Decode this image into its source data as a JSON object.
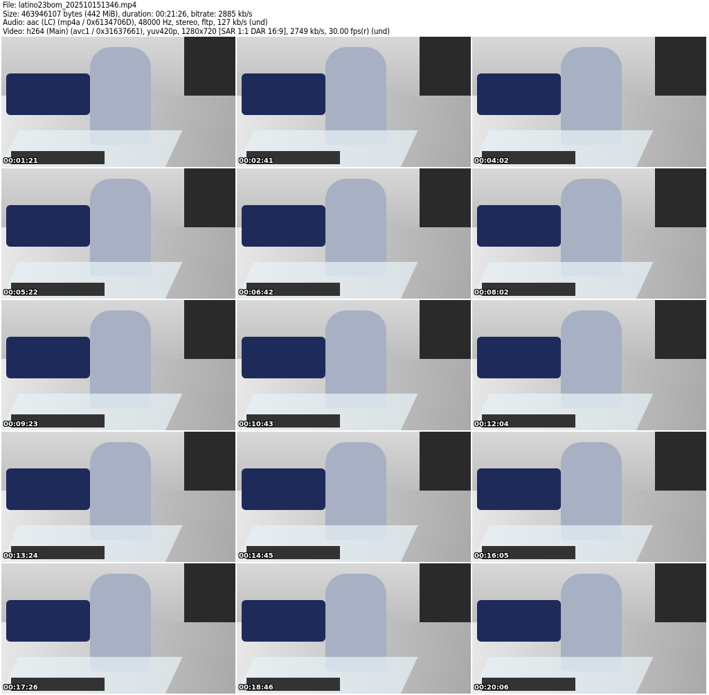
{
  "header": {
    "file": "File: latino23bom_202510151346.mp4",
    "size": "Size: 463946107 bytes (442 MiB), duration: 00:21:26, bitrate: 2885 kb/s",
    "audio": "Audio: aac (LC) (mp4a / 0x6134706D), 48000 Hz, stereo, fltp, 127 kb/s (und)",
    "video": "Video: h264 (Main) (avc1 / 0x31637661), yuv420p, 1280x720 [SAR 1:1 DAR 16:9], 2749 kb/s, 30.00 fps(r) (und)"
  },
  "thumbnails": [
    {
      "timestamp": "00:01:21"
    },
    {
      "timestamp": "00:02:41"
    },
    {
      "timestamp": "00:04:02"
    },
    {
      "timestamp": "00:05:22"
    },
    {
      "timestamp": "00:06:42"
    },
    {
      "timestamp": "00:08:02"
    },
    {
      "timestamp": "00:09:23"
    },
    {
      "timestamp": "00:10:43"
    },
    {
      "timestamp": "00:12:04"
    },
    {
      "timestamp": "00:13:24"
    },
    {
      "timestamp": "00:14:45"
    },
    {
      "timestamp": "00:16:05"
    },
    {
      "timestamp": "00:17:26"
    },
    {
      "timestamp": "00:18:46"
    },
    {
      "timestamp": "00:20:06"
    }
  ]
}
